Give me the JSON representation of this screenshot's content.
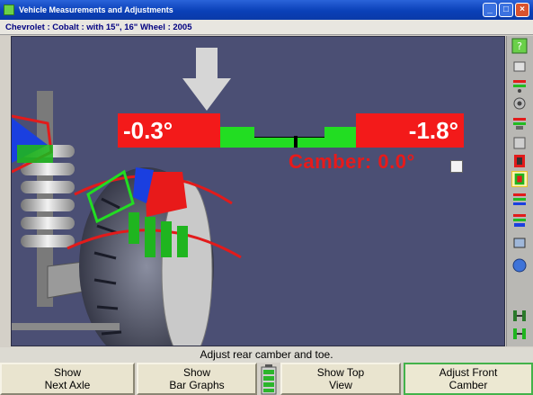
{
  "window": {
    "title": "Vehicle Measurements and Adjustments",
    "buttons": {
      "minimize": "_",
      "maximize": "□",
      "close": "×"
    }
  },
  "vehicle_line": "Chevrolet : Cobalt : with 15\", 16\" Wheel : 2005",
  "readout": {
    "left_value": "-0.3°",
    "right_value": "-1.8°",
    "camber_label": "Camber:  0.0°"
  },
  "colors": {
    "viewport_bg": "#4b4f74",
    "out_of_spec": "#f31a1a",
    "in_spec": "#22dd22",
    "arrow": "#d6d6d6"
  },
  "side_toolbar": [
    {
      "icon": "help-wizard-icon"
    },
    {
      "icon": "vehicle-spec-icon"
    },
    {
      "icon": "alignment-readings-icon"
    },
    {
      "icon": "camera-icon"
    },
    {
      "icon": "vehicle-rear-icon"
    },
    {
      "icon": "bar-graph-icon"
    },
    {
      "icon": "wheel-icon"
    },
    {
      "icon": "vehicle-front-icon"
    },
    {
      "icon": "sensor-icon"
    },
    {
      "icon": "print-icon"
    },
    {
      "icon": "globe-icon"
    },
    {
      "icon": "axle-icon"
    },
    {
      "icon": "axle-adjust-icon"
    }
  ],
  "instruction": "Adjust rear camber and toe.",
  "bottom_buttons": [
    {
      "line1": "Show",
      "line2": "Next Axle"
    },
    {
      "line1": "Show",
      "line2": "Bar Graphs"
    },
    {
      "line1": "Show Top",
      "line2": "View"
    },
    {
      "line1": "Adjust Front",
      "line2": "Camber"
    }
  ]
}
